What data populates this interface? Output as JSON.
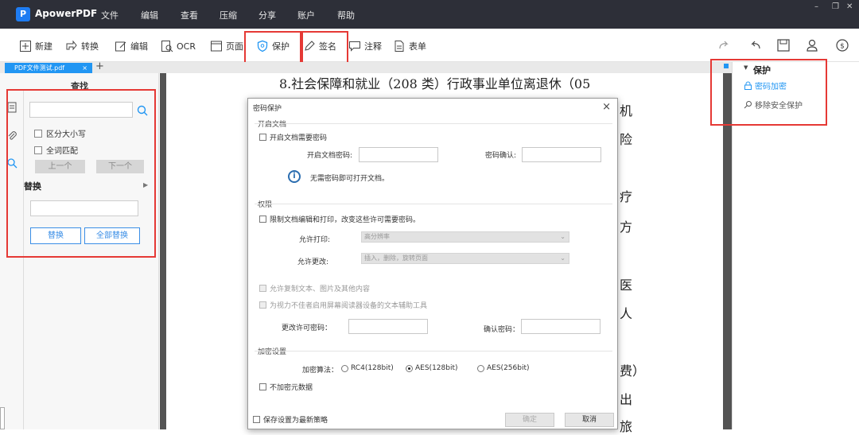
{
  "app": {
    "name": "ApowerPDF",
    "logo_letter": "P",
    "menu": [
      "文件",
      "编辑",
      "查看",
      "压缩",
      "分享",
      "账户",
      "帮助"
    ]
  },
  "toolbar": {
    "new_label": "新建",
    "convert_label": "转换",
    "edit_label": "编辑",
    "ocr_label": "OCR",
    "page_label": "页面",
    "protect_label": "保护",
    "sign_label": "签名",
    "comment_label": "注释",
    "form_label": "表单"
  },
  "tabs": {
    "doc_tab": "PDF文件测试.pdf",
    "close": "×",
    "add": "+"
  },
  "left_panel": {
    "title": "查找",
    "search_placeholder": "",
    "case_sensitive": "区分大小写",
    "whole_word": "全词匹配",
    "prev": "上一个",
    "next": "下一个",
    "replace_title": "替换",
    "replace_btn": "替换",
    "replace_all_btn": "全部替换"
  },
  "document": {
    "line1": "8.社会保障和就业（208 类）行政事业单位离退休（05",
    "r1": "机",
    "r2": "险",
    "r3": "疗",
    "r4": "方",
    "r5": "医",
    "r6": "人",
    "r7": "费）",
    "r8": "出",
    "r9": "旅"
  },
  "right_panel": {
    "title": "保护",
    "password_encrypt": "密码加密",
    "remove_security": "移除安全保护"
  },
  "dialog": {
    "title": "密码保护",
    "close": "×",
    "open_group": "开启文档",
    "open_require": "开启文档需要密码",
    "open_pwd_label": "开启文档密码:",
    "confirm_label": "密码确认:",
    "info_text": "无需密码即可打开文档。",
    "perm_group": "权限",
    "restrict": "限制文档编辑和打印，改变这些许可需要密码。",
    "allow_print": "允许打印:",
    "print_value": "高分辨率",
    "allow_change": "允许更改:",
    "change_value": "插入，删除，旋转页面",
    "allow_copy": "允许复制文本、图片及其他内容",
    "allow_reader": "为视力不佳者启用屏幕阅读器设备的文本辅助工具",
    "change_pwd_label": "更改许可密码：",
    "confirm2_label": "确认密码：",
    "enc_group": "加密设置",
    "algo_label": "加密算法：",
    "rc4": "RC4(128bit)",
    "aes128": "AES(128bit)",
    "aes256": "AES(256bit)",
    "no_meta": "不加密元数据",
    "save_default": "保存设置为最新策略",
    "ok": "确定",
    "cancel": "取消"
  },
  "colors": {
    "titlebar": "#2d2f38",
    "accent_blue": "#2196f3",
    "highlight_red": "#e53935"
  }
}
